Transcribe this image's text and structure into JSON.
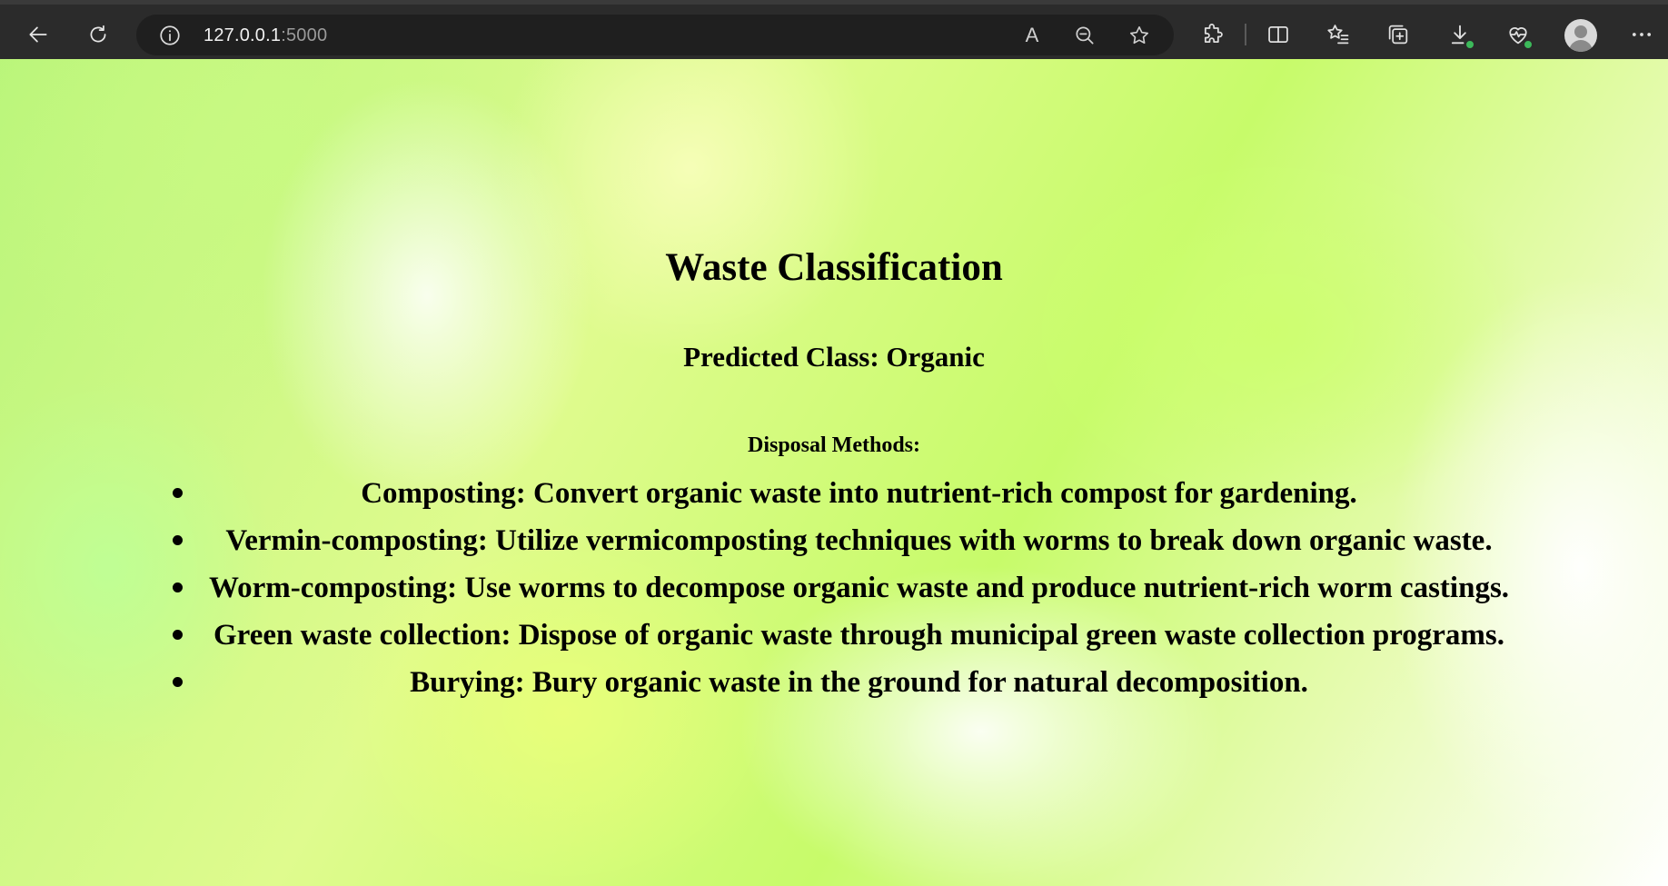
{
  "browser": {
    "url_host": "127.0.0.1",
    "url_port": ":5000",
    "read_aloud_glyph": "A",
    "icons": [
      "back-icon",
      "reload-icon",
      "info-icon",
      "read-aloud-icon",
      "zoom-out-icon",
      "favorite-star-icon",
      "extensions-icon",
      "split-screen-icon",
      "favorites-icon",
      "collections-icon",
      "downloads-icon",
      "browser-essentials-icon",
      "profile-avatar",
      "more-menu-icon"
    ]
  },
  "page": {
    "title": "Waste Classification",
    "predicted": "Predicted Class: Organic",
    "disposal_heading": "Disposal Methods:",
    "methods": [
      "Composting: Convert organic waste into nutrient-rich compost for gardening.",
      "Vermin-composting: Utilize vermicomposting techniques with worms to break down organic waste.",
      "Worm-composting: Use worms to decompose organic waste and produce nutrient-rich worm castings.",
      "Green waste collection: Dispose of organic waste through municipal green waste collection programs.",
      "Burying: Bury organic waste in the ground for natural decomposition."
    ]
  },
  "colors": {
    "chrome_bg": "#2b2b2b",
    "addressbar_bg": "#1f1f1f",
    "badge_green": "#3cb95a",
    "page_green": "#c7fb6a"
  }
}
